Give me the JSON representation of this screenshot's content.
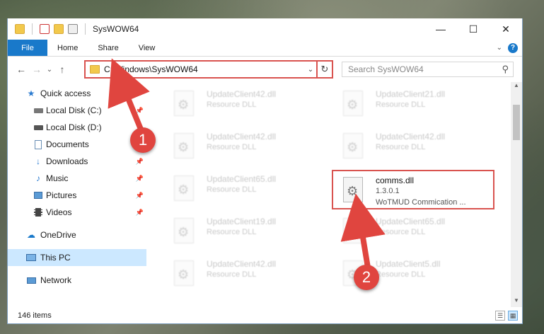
{
  "window": {
    "title": "SysWOW64",
    "controls": {
      "minimize": "—",
      "maximize": "☐",
      "close": "✕"
    }
  },
  "ribbon": {
    "file": "File",
    "tabs": [
      "Home",
      "Share",
      "View"
    ],
    "expand_icon": "chevron-down-icon",
    "help": "?"
  },
  "nav": {
    "back": "←",
    "forward": "→",
    "recent": "⌄",
    "up": "↑",
    "address": "C:\\Windows\\SysWOW64",
    "refresh": "↻",
    "search_placeholder": "Search SysWOW64"
  },
  "sidebar": {
    "quick_access": "Quick access",
    "items": [
      {
        "label": "Local Disk (C:)",
        "icon": "drive-icon",
        "pinned": true
      },
      {
        "label": "Local Disk (D:)",
        "icon": "drive-icon",
        "pinned": false
      },
      {
        "label": "Documents",
        "icon": "documents-icon",
        "pinned": true
      },
      {
        "label": "Downloads",
        "icon": "downloads-icon",
        "pinned": true
      },
      {
        "label": "Music",
        "icon": "music-icon",
        "pinned": true
      },
      {
        "label": "Pictures",
        "icon": "pictures-icon",
        "pinned": true
      },
      {
        "label": "Videos",
        "icon": "videos-icon",
        "pinned": true
      }
    ],
    "onedrive": "OneDrive",
    "this_pc": "This PC",
    "network": "Network"
  },
  "files": [
    {
      "name": "UpdateClient42.dll",
      "type": "Resource DLL"
    },
    {
      "name": "UpdateClient21.dll",
      "type": "Resource DLL"
    },
    {
      "name": "UpdateClient42.dll",
      "type": "Resource DLL"
    },
    {
      "name": "UpdateClient42.dll",
      "type": "Resource DLL"
    },
    {
      "name": "UpdateClient65.dll",
      "type": "Resource DLL"
    },
    {
      "name": "comms.dll",
      "version": "1.3.0.1",
      "description": "WoTMUD Commication ..."
    },
    {
      "name": "UpdateClient19.dll",
      "type": "Resource DLL"
    },
    {
      "name": "UpdateClient65.dll",
      "type": "Resource DLL"
    },
    {
      "name": "UpdateClient42.dll",
      "type": "Resource DLL"
    },
    {
      "name": "UpdateClient5.dll",
      "type": "Resource DLL"
    }
  ],
  "status": {
    "item_count": "146 items"
  },
  "annotations": {
    "step1": "1",
    "step2": "2",
    "highlight_color": "#d9534f",
    "callout_color": "#e0453f"
  },
  "colors": {
    "accent": "#1979ca",
    "selection": "#cce8ff"
  }
}
